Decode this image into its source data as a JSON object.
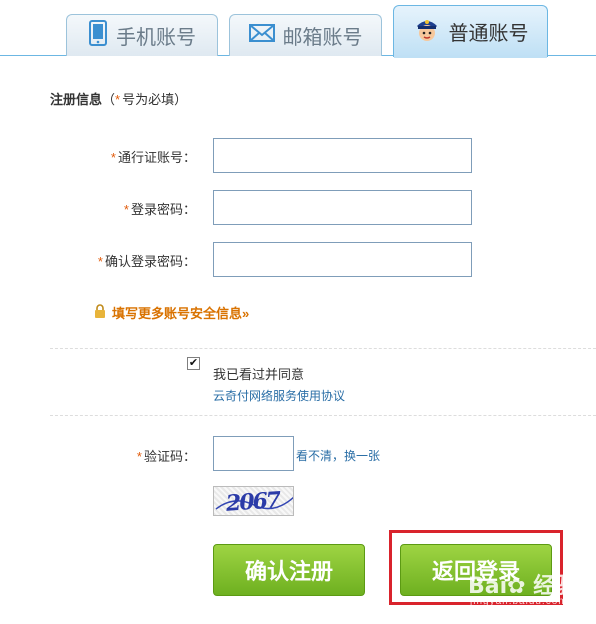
{
  "tabs": [
    {
      "label": "手机账号",
      "icon": "phone-icon",
      "active": false
    },
    {
      "label": "邮箱账号",
      "icon": "mail-icon",
      "active": false
    },
    {
      "label": "普通账号",
      "icon": "police-avatar-icon",
      "active": true
    }
  ],
  "section": {
    "title": "注册信息",
    "hint_open": "（",
    "hint_star": "*",
    "hint_text": "号为必填）"
  },
  "fields": {
    "account_label": "通行证账号：",
    "account_value": "",
    "password_label": "登录密码：",
    "password_value": "",
    "confirm_label": "确认登录密码：",
    "confirm_value": "",
    "required_mark": "*"
  },
  "more_security_link": "填写更多账号安全信息»",
  "agreement": {
    "checked": true,
    "check_mark": "✔",
    "text": "我已看过并同意",
    "link": "云奇付网络服务使用协议"
  },
  "captcha": {
    "label": "验证码：",
    "value": "",
    "refresh_text": "看不清，换一张",
    "image_text": "2067"
  },
  "buttons": {
    "confirm": "确认注册",
    "back": "返回登录"
  },
  "watermark": {
    "main": "Bai✿ 经验",
    "sub": "jingyan.baidu.com"
  },
  "colors": {
    "accent_blue": "#6cb7e3",
    "required_orange": "#e25c0c",
    "link_blue": "#2a6ea6",
    "button_green": "#7cbd27",
    "highlight_red": "#d9232c"
  }
}
